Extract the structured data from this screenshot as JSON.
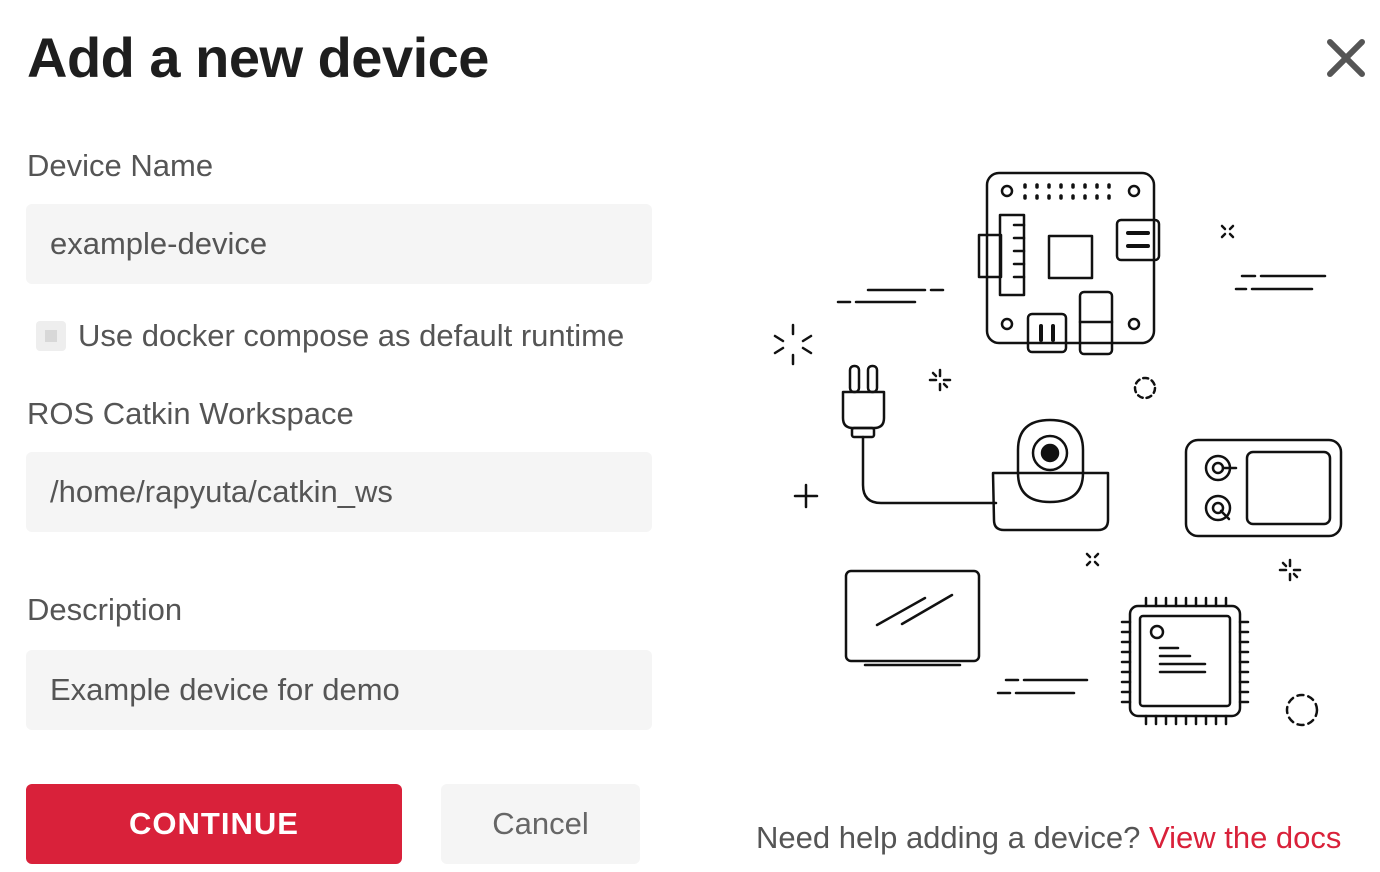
{
  "dialog": {
    "title": "Add a new device",
    "close_icon": "close-icon"
  },
  "form": {
    "device_name": {
      "label": "Device Name",
      "value": "example-device"
    },
    "docker_compose": {
      "label": "Use docker compose as default runtime",
      "checked": false
    },
    "catkin_workspace": {
      "label": "ROS Catkin Workspace",
      "value": "/home/rapyuta/catkin_ws"
    },
    "description": {
      "label": "Description",
      "value": "Example device for demo"
    }
  },
  "actions": {
    "continue_label": "CONTINUE",
    "cancel_label": "Cancel"
  },
  "help": {
    "text": "Need help adding a device?",
    "link_text": "View the docs"
  },
  "colors": {
    "accent": "#d9213a",
    "field_bg": "#f5f5f5",
    "text_muted": "#555555",
    "title": "#1e1e1e"
  }
}
